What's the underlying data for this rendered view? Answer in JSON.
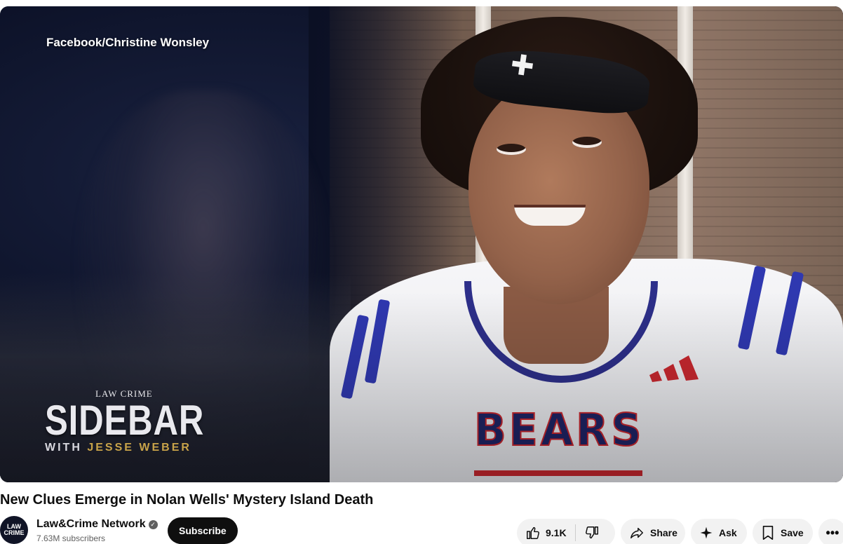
{
  "video": {
    "credit_overlay": "Facebook/Christine Wonsley",
    "show_brand": {
      "top": "LAW CRIME",
      "main": "SIDEBAR",
      "sub_prefix": "WITH ",
      "sub_host": "JESSE WEBER"
    },
    "jersey_text": "BEARS"
  },
  "title": "New Clues Emerge in Nolan Wells' Mystery Island Death",
  "channel": {
    "avatar_text": "LAW CRIME",
    "name": "Law&Crime Network",
    "verified_icon": "✓",
    "subscribers": "7.63M subscribers",
    "subscribe_label": "Subscribe"
  },
  "actions": {
    "like_count": "9.1K",
    "share_label": "Share",
    "ask_label": "Ask",
    "save_label": "Save",
    "more_icon": "•••"
  },
  "colors": {
    "accent_dark": "#0f0f0f",
    "pill_bg": "#f2f2f2",
    "brand_gold": "#c8a349"
  }
}
